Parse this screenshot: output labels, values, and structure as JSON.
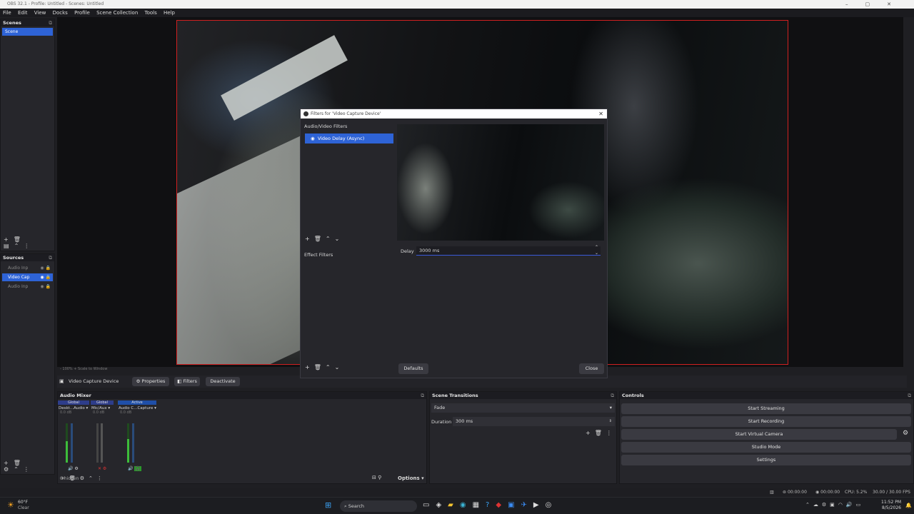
{
  "window": {
    "title": "OBS 32.1 - Profile: Untitled - Scenes: Untitled"
  },
  "menu": [
    "File",
    "Edit",
    "View",
    "Docks",
    "Profile",
    "Scene Collection",
    "Tools",
    "Help"
  ],
  "scenes": {
    "title": "Scenes",
    "items": [
      "Scene"
    ]
  },
  "sources": {
    "title": "Sources",
    "items": [
      "Audio Inp",
      "Video Cap",
      "Audio Inp"
    ]
  },
  "zoom_bar": {
    "text": "- 100% + Scale to Window"
  },
  "source_toolbar": {
    "source_name": "Video Capture Device",
    "properties": "Properties",
    "filters": "Filters",
    "deactivate": "Deactivate"
  },
  "filters_dialog": {
    "title": "Filters for 'Video Capture Device'",
    "av_section": "Audio/Video Filters",
    "av_items": [
      "Video Delay (Async)"
    ],
    "effect_section": "Effect Filters",
    "delay_label": "Delay",
    "delay_value": "3000 ms",
    "defaults": "Defaults",
    "close": "Close"
  },
  "audio_mixer": {
    "title": "Audio Mixer",
    "channels": [
      {
        "badge": "Global",
        "name": "Deskt...Audio",
        "level": "0.0 dB",
        "fill": 0.55
      },
      {
        "badge": "Global",
        "name": "Mic/Aux",
        "level": "0.0 dB",
        "fill": 0.0
      },
      {
        "badge": "Active",
        "name": "Audio C...Capture",
        "level": "0.0 dB",
        "fill": 0.6
      }
    ],
    "hidden": "0 hidden",
    "options": "Options"
  },
  "scene_transitions": {
    "title": "Scene Transitions",
    "transition": "Fade",
    "duration_label": "Duration",
    "duration_value": "300 ms"
  },
  "controls": {
    "title": "Controls",
    "buttons": [
      "Start Streaming",
      "Start Recording",
      "Start Virtual Camera",
      "Studio Mode",
      "Settings"
    ]
  },
  "statusbar": {
    "stream_time": "00:00:00",
    "rec_time": "00:00:00",
    "cpu": "CPU: 5.2%",
    "fps": "30.00 / 30.00 FPS"
  },
  "taskbar": {
    "weather_temp": "60°F",
    "weather_desc": "Clear",
    "search_placeholder": "Search",
    "time": "11:52 PM",
    "date": "8/5/2026"
  }
}
